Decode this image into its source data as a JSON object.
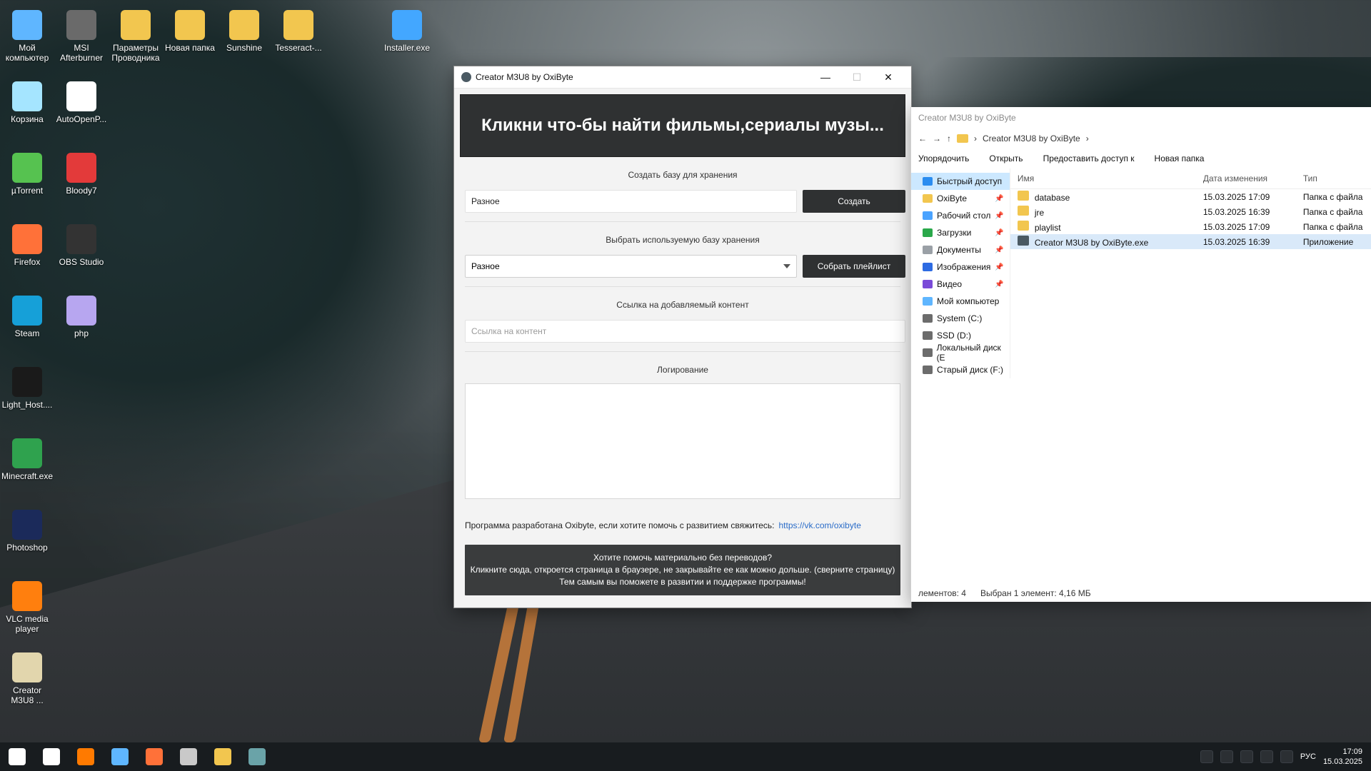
{
  "desktop": {
    "icons": [
      {
        "label": "Мой компьютер",
        "icon": "monitor-icon",
        "color": "#5fb6ff"
      },
      {
        "label": "MSI Afterburner",
        "icon": "msi-icon",
        "color": "#6a6a6a"
      },
      {
        "label": "Параметры Проводника",
        "icon": "folder-check-icon",
        "color": "#f2c64f"
      },
      {
        "label": "Новая папка",
        "icon": "folder-icon",
        "color": "#f2c64f"
      },
      {
        "label": "Sunshine",
        "icon": "archive-icon",
        "color": "#f2c64f"
      },
      {
        "label": "Tesseract-...",
        "icon": "archive-icon",
        "color": "#f2c64f"
      },
      {
        "label": "Installer.exe",
        "icon": "download-icon",
        "color": "#43a7ff"
      },
      {
        "label": "Корзина",
        "icon": "recycle-bin-icon",
        "color": "#a5e5ff"
      },
      {
        "label": "AutoOpenP...",
        "icon": "java-icon",
        "color": "#ffffff"
      },
      {
        "label": "µTorrent",
        "icon": "utorrent-icon",
        "color": "#56c250"
      },
      {
        "label": "Bloody7",
        "icon": "bloody-icon",
        "color": "#e33a3a"
      },
      {
        "label": "Firefox",
        "icon": "firefox-icon",
        "color": "#ff7139"
      },
      {
        "label": "OBS Studio",
        "icon": "obs-icon",
        "color": "#333333"
      },
      {
        "label": "Steam",
        "icon": "steam-icon",
        "color": "#16a0d8"
      },
      {
        "label": "php",
        "icon": "php-icon",
        "color": "#b7a6f0"
      },
      {
        "label": "Light_Host....",
        "icon": "light-host-icon",
        "color": "#1a1a1a"
      },
      {
        "label": "Minecraft.exe",
        "icon": "minecraft-icon",
        "color": "#2fa24e"
      },
      {
        "label": "Photoshop",
        "icon": "photoshop-icon",
        "color": "#1b2a5a"
      },
      {
        "label": "VLC media player",
        "icon": "vlc-icon",
        "color": "#ff7f0e"
      },
      {
        "label": "Creator M3U8 ...",
        "icon": "creator-icon",
        "color": "#e2d6ad"
      }
    ]
  },
  "app": {
    "title": "Creator M3U8 by OxiByte",
    "banner": "Кликни что-бы найти фильмы,сериалы музы...",
    "create_label": "Создать базу для хранения",
    "create_input_value": "Разное",
    "create_button": "Создать",
    "select_label": "Выбрать используемую базу хранения",
    "select_value": "Разное",
    "build_playlist_button": "Собрать плейлист",
    "link_label": "Ссылка на добавляемый контент",
    "link_placeholder": "Ссылка на контент",
    "log_label": "Логирование",
    "credits_text": "Программа разработана Oxibyte, если хотите помочь с развитием свяжитесь:",
    "credits_link": "https://vk.com/oxibyte",
    "donate_lines": [
      "Хотите помочь материально без переводов?",
      "Кликните сюда, откроется страница в браузере, не закрывайте ее как можно дольше. (сверните страницу)",
      "Тем самым вы поможете в развитии и поддержке программы!"
    ]
  },
  "explorer": {
    "title": "Creator M3U8 by OxiByte",
    "path": "Creator M3U8 by OxiByte",
    "toolbar": [
      "Упорядочить",
      "Открыть",
      "Предоставить доступ к",
      "Новая папка"
    ],
    "nav": [
      {
        "label": "Быстрый доступ",
        "icon": "star-icon",
        "active": true,
        "pin": false
      },
      {
        "label": "OxiByte",
        "icon": "folder-icon",
        "active": false,
        "pin": true
      },
      {
        "label": "Рабочий стол",
        "icon": "desktop-icon",
        "active": false,
        "pin": true
      },
      {
        "label": "Загрузки",
        "icon": "download-icon",
        "active": false,
        "pin": true
      },
      {
        "label": "Документы",
        "icon": "documents-icon",
        "active": false,
        "pin": true
      },
      {
        "label": "Изображения",
        "icon": "images-icon",
        "active": false,
        "pin": true
      },
      {
        "label": "Видео",
        "icon": "video-icon",
        "active": false,
        "pin": true
      },
      {
        "label": "Мой компьютер",
        "icon": "pc-icon",
        "active": false,
        "pin": false
      },
      {
        "label": "System (C:)",
        "icon": "drive-icon",
        "active": false,
        "pin": false
      },
      {
        "label": "SSD (D:)",
        "icon": "drive-icon",
        "active": false,
        "pin": false
      },
      {
        "label": "Локальный диск (E",
        "icon": "drive-icon",
        "active": false,
        "pin": false
      },
      {
        "label": "Старый диск (F:)",
        "icon": "drive-icon",
        "active": false,
        "pin": false
      }
    ],
    "columns": [
      "Имя",
      "Дата изменения",
      "Тип"
    ],
    "rows": [
      {
        "name": "database",
        "date": "15.03.2025 17:09",
        "type": "Папка с файла",
        "icon": "folder-icon",
        "selected": false
      },
      {
        "name": "jre",
        "date": "15.03.2025 16:39",
        "type": "Папка с файла",
        "icon": "folder-icon",
        "selected": false
      },
      {
        "name": "playlist",
        "date": "15.03.2025 17:09",
        "type": "Папка с файла",
        "icon": "folder-icon",
        "selected": false
      },
      {
        "name": "Creator M3U8 by OxiByte.exe",
        "date": "15.03.2025 16:39",
        "type": "Приложение",
        "icon": "app-icon",
        "selected": true
      }
    ],
    "status_left": "лементов: 4",
    "status_right": "Выбран 1 элемент: 4,16 МБ"
  },
  "taskbar": {
    "apps": [
      "windows-start-icon",
      "search-icon",
      "browser-icon",
      "control-panel-icon",
      "firefox-icon",
      "obs-icon",
      "file-explorer-icon",
      "creator-icon"
    ],
    "tray": {
      "lang": "РУС",
      "time": "17:09",
      "date": "15.03.2025"
    }
  }
}
